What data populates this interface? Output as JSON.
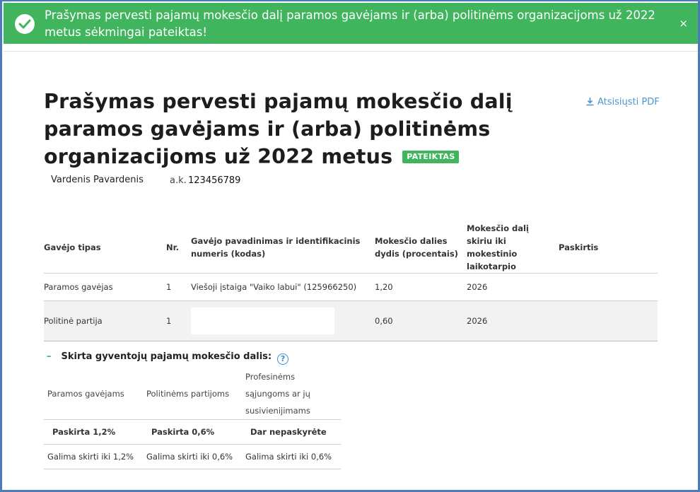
{
  "banner": {
    "message": "Prašymas pervesti pajamų mokesčio dalį paramos gavėjams ir (arba) politinėms organizacijoms už 2022 metus sėkmingai pateiktas!",
    "close": "×",
    "icon": "check-circle-icon"
  },
  "page": {
    "title": "Prašymas pervesti pajamų mokesčio dalį paramos gavėjams ir (arba) politinėms organizacijoms už 2022 metus",
    "status": "PATEIKTAS",
    "download_pdf": "Atsisiųsti PDF",
    "person_name": "Vardenis Pavardenis",
    "ak_label": "a.k.",
    "ak_value": "123456789"
  },
  "table": {
    "headers": [
      "Gavėjo tipas",
      "Nr.",
      "Gavėjo pavadinimas ir identifikacinis numeris (kodas)",
      "Mokesčio dalies dydis (procentais)",
      "Mokesčio dalį skiriu iki mokestinio laikotarpio",
      "Paskirtis"
    ],
    "rows": [
      {
        "type": "Paramos gavėjas",
        "nr": "1",
        "name": "Viešoji įstaiga \"Vaiko labui\" (125966250)",
        "percent": "1,20",
        "until": "2026",
        "purpose": ""
      },
      {
        "type": "Politinė partija",
        "nr": "1",
        "name": "",
        "percent": "0,60",
        "until": "2026",
        "purpose": ""
      }
    ]
  },
  "share": {
    "title": "Skirta gyventojų pajamų mokesčio dalis:",
    "toggle": "–",
    "help": "?",
    "columns": [
      "Paramos gavėjams",
      "Politinėms partijoms",
      "Profesinėms sąjungoms ar jų susivienijimams"
    ],
    "status": [
      "Paskirta 1,2%",
      "Paskirta 0,6%",
      "Dar nepaskyrėte"
    ],
    "limits": [
      "Galima skirti iki 1,2%",
      "Galima skirti iki 0,6%",
      "Galima skirti iki 0,6%"
    ]
  },
  "colors": {
    "accent_green": "#40b55e",
    "link_blue": "#4d97c9",
    "alert_red": "#e0394a"
  }
}
